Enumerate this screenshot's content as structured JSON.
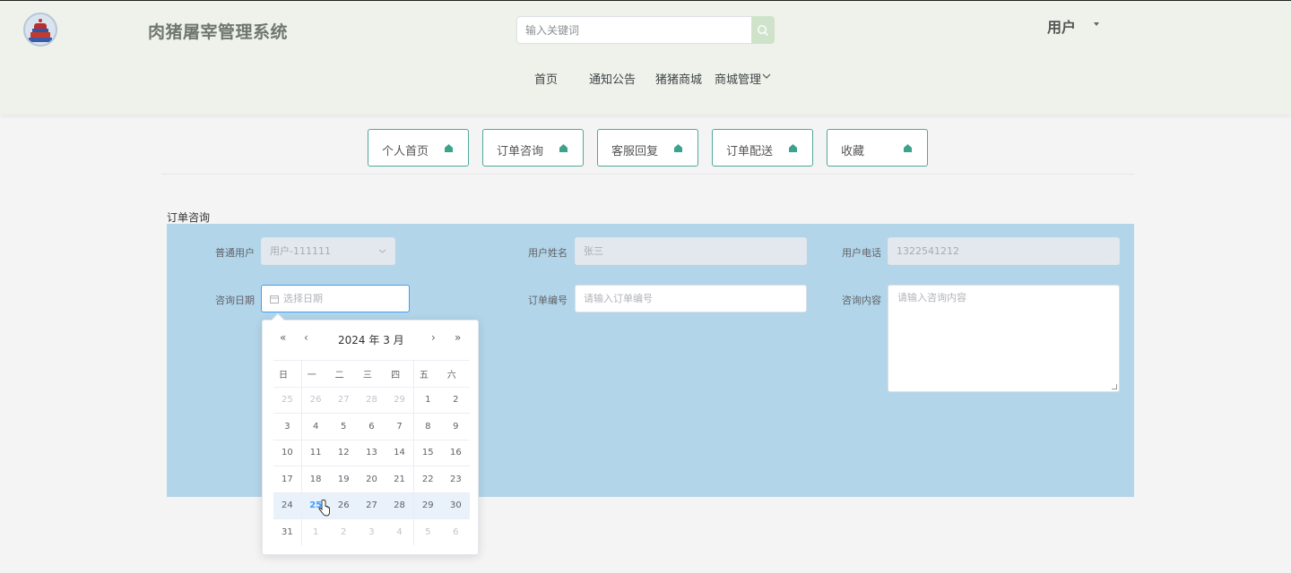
{
  "header": {
    "title": "肉猪屠宰管理系统",
    "search_placeholder": "输入关键词",
    "user_label": "用户",
    "nav": [
      "首页",
      "通知公告",
      "猪猪商城",
      "商城管理"
    ]
  },
  "tabs": [
    "个人首页",
    "订单咨询",
    "客服回复",
    "订单配送",
    "收藏"
  ],
  "form": {
    "section_title": "订单咨询",
    "labels": {
      "user": "普通用户",
      "name": "用户姓名",
      "phone": "用户电话",
      "date": "咨询日期",
      "order_no": "订单编号",
      "content": "咨询内容"
    },
    "values": {
      "user": "用户-111111",
      "name": "张三",
      "phone": "1322541212"
    },
    "placeholders": {
      "date": "选择日期",
      "order_no": "请输入订单编号",
      "content": "请输入咨询内容"
    }
  },
  "datepicker": {
    "year": "2024 年",
    "month": "3 月",
    "weekdays": [
      "日",
      "一",
      "二",
      "三",
      "四",
      "五",
      "六"
    ],
    "weeks": [
      [
        [
          "25",
          "prev"
        ],
        [
          "26",
          "prev"
        ],
        [
          "27",
          "prev"
        ],
        [
          "28",
          "prev"
        ],
        [
          "29",
          "prev"
        ],
        [
          "1",
          ""
        ],
        [
          "2",
          ""
        ]
      ],
      [
        [
          "3",
          ""
        ],
        [
          "4",
          ""
        ],
        [
          "5",
          ""
        ],
        [
          "6",
          ""
        ],
        [
          "7",
          ""
        ],
        [
          "8",
          ""
        ],
        [
          "9",
          ""
        ]
      ],
      [
        [
          "10",
          ""
        ],
        [
          "11",
          ""
        ],
        [
          "12",
          ""
        ],
        [
          "13",
          ""
        ],
        [
          "14",
          ""
        ],
        [
          "15",
          ""
        ],
        [
          "16",
          ""
        ]
      ],
      [
        [
          "17",
          ""
        ],
        [
          "18",
          ""
        ],
        [
          "19",
          ""
        ],
        [
          "20",
          ""
        ],
        [
          "21",
          ""
        ],
        [
          "22",
          ""
        ],
        [
          "23",
          ""
        ]
      ],
      [
        [
          "24",
          ""
        ],
        [
          "25",
          "today"
        ],
        [
          "26",
          ""
        ],
        [
          "27",
          ""
        ],
        [
          "28",
          ""
        ],
        [
          "29",
          ""
        ],
        [
          "30",
          ""
        ]
      ],
      [
        [
          "31",
          ""
        ],
        [
          "1",
          "next"
        ],
        [
          "2",
          "next"
        ],
        [
          "3",
          "next"
        ],
        [
          "4",
          "next"
        ],
        [
          "5",
          "next"
        ],
        [
          "6",
          "next"
        ]
      ]
    ]
  },
  "colors": {
    "accent": "#4fa89a",
    "header_bg": "#eef2ea",
    "panel_bg": "#b3d5e9",
    "today": "#409eff"
  }
}
